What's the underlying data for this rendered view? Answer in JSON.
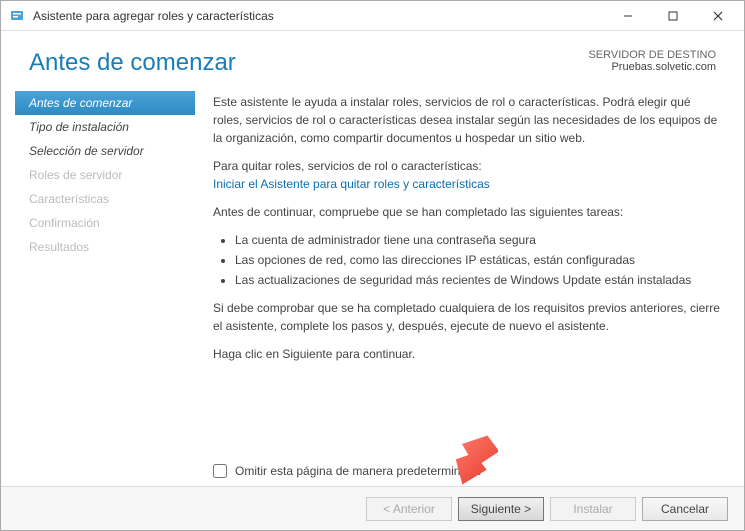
{
  "titlebar": {
    "title": "Asistente para agregar roles y características"
  },
  "header": {
    "title": "Antes de comenzar",
    "dest_label": "SERVIDOR DE DESTINO",
    "dest_server": "Pruebas.solvetic.com"
  },
  "sidebar": {
    "items": [
      {
        "label": "Antes de comenzar",
        "active": true,
        "enabled": true
      },
      {
        "label": "Tipo de instalación",
        "active": false,
        "enabled": true
      },
      {
        "label": "Selección de servidor",
        "active": false,
        "enabled": true
      },
      {
        "label": "Roles de servidor",
        "active": false,
        "enabled": false
      },
      {
        "label": "Características",
        "active": false,
        "enabled": false
      },
      {
        "label": "Confirmación",
        "active": false,
        "enabled": false
      },
      {
        "label": "Resultados",
        "active": false,
        "enabled": false
      }
    ]
  },
  "content": {
    "intro": "Este asistente le ayuda a instalar roles, servicios de rol o características. Podrá elegir qué roles, servicios de rol o características desea instalar según las necesidades de los equipos de la organización, como compartir documentos u hospedar un sitio web.",
    "remove_label": "Para quitar roles, servicios de rol o características:",
    "remove_link": "Iniciar el Asistente para quitar roles y características",
    "precheck_label": "Antes de continuar, compruebe que se han completado las siguientes tareas:",
    "bullets": [
      "La cuenta de administrador tiene una contraseña segura",
      "Las opciones de red, como las direcciones IP estáticas, están configuradas",
      "Las actualizaciones de seguridad más recientes de Windows Update están instaladas"
    ],
    "verify": "Si debe comprobar que se ha completado cualquiera de los requisitos previos anteriores, cierre el asistente, complete los pasos y, después, ejecute de nuevo el asistente.",
    "continue": "Haga clic en Siguiente para continuar."
  },
  "skip": {
    "label": "Omitir esta página de manera predeterminada",
    "checked": false
  },
  "footer": {
    "previous": "< Anterior",
    "next": "Siguiente >",
    "install": "Instalar",
    "cancel": "Cancelar"
  }
}
